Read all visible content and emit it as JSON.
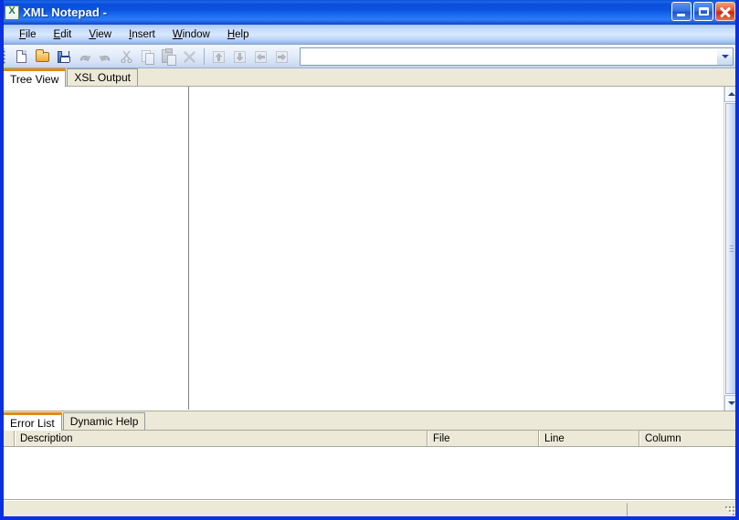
{
  "window": {
    "title": "XML Notepad -",
    "icon": "xml-document-icon",
    "controls": {
      "minimize": "Minimize",
      "maximize": "Restore",
      "close": "Close"
    }
  },
  "menu": {
    "items": [
      {
        "label": "File",
        "accel": "F"
      },
      {
        "label": "Edit",
        "accel": "E"
      },
      {
        "label": "View",
        "accel": "V"
      },
      {
        "label": "Insert",
        "accel": "I"
      },
      {
        "label": "Window",
        "accel": "W"
      },
      {
        "label": "Help",
        "accel": "H"
      }
    ]
  },
  "toolbar": {
    "buttons": [
      {
        "name": "new-button",
        "icon": "new-document-icon",
        "tooltip": "New",
        "disabled": false
      },
      {
        "name": "open-button",
        "icon": "open-folder-icon",
        "tooltip": "Open",
        "disabled": false
      },
      {
        "name": "save-button",
        "icon": "floppy-disk-icon",
        "tooltip": "Save",
        "disabled": false
      },
      {
        "name": "undo-button",
        "icon": "undo-arrow-icon",
        "tooltip": "Undo",
        "disabled": true
      },
      {
        "name": "redo-button",
        "icon": "redo-arrow-icon",
        "tooltip": "Redo",
        "disabled": true
      },
      {
        "name": "cut-button",
        "icon": "scissors-icon",
        "tooltip": "Cut",
        "disabled": true
      },
      {
        "name": "copy-button",
        "icon": "copy-pages-icon",
        "tooltip": "Copy",
        "disabled": true
      },
      {
        "name": "paste-button",
        "icon": "clipboard-icon",
        "tooltip": "Paste",
        "disabled": true
      },
      {
        "name": "delete-button",
        "icon": "x-delete-icon",
        "tooltip": "Delete",
        "disabled": true
      },
      {
        "name": "nudge-up-button",
        "icon": "nudge-up-icon",
        "tooltip": "Nudge Up",
        "disabled": true
      },
      {
        "name": "nudge-down-button",
        "icon": "nudge-down-icon",
        "tooltip": "Nudge Down",
        "disabled": true
      },
      {
        "name": "nudge-left-button",
        "icon": "nudge-left-icon",
        "tooltip": "Nudge Left",
        "disabled": true
      },
      {
        "name": "nudge-right-button",
        "icon": "nudge-right-icon",
        "tooltip": "Nudge Right",
        "disabled": true
      }
    ],
    "address_combo": {
      "value": "",
      "placeholder": "",
      "dropdown_icon": "chevron-down-icon"
    }
  },
  "main_tabs": {
    "items": [
      {
        "label": "Tree View",
        "active": true
      },
      {
        "label": "XSL Output",
        "active": false
      }
    ]
  },
  "tree_view": {
    "tree_pane_content": "",
    "node_pane_content": "",
    "scrollbar": {
      "up_icon": "scroll-up-arrow-icon",
      "down_icon": "scroll-down-arrow-icon"
    }
  },
  "bottom_tabs": {
    "items": [
      {
        "label": "Error List",
        "active": true
      },
      {
        "label": "Dynamic Help",
        "active": false
      }
    ]
  },
  "error_list": {
    "columns": [
      "",
      "Description",
      "File",
      "Line",
      "Column"
    ],
    "rows": []
  },
  "statusbar": {
    "left_text": "",
    "right_text": "",
    "grip": "resize-grip-icon"
  },
  "colors": {
    "title_blue": "#0A52D8",
    "window_border": "#0A30E0",
    "active_tab_accent": "#E08A18",
    "control_face": "#ECE9D8",
    "content_white": "#FFFFFF"
  }
}
